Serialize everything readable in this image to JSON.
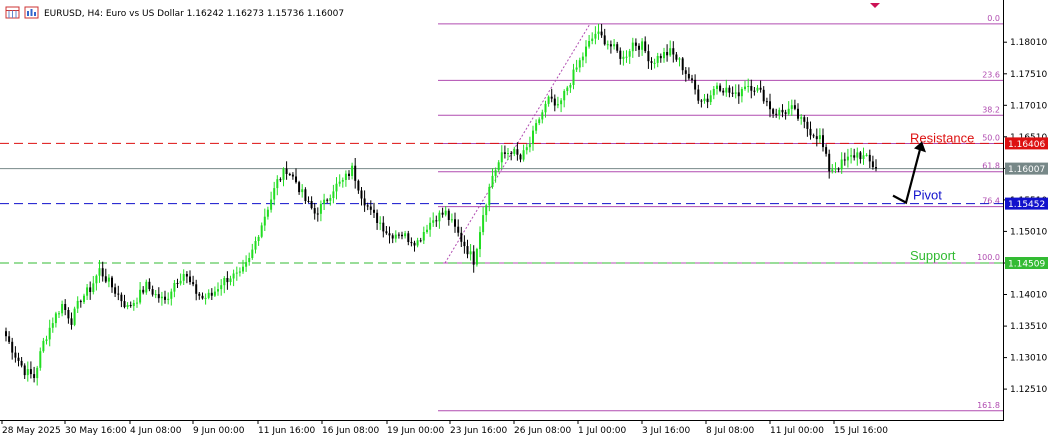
{
  "header": {
    "symbol_line": "EURUSD, H4:  Euro vs US Dollar  1.16242  1.16273  1.15736  1.16007"
  },
  "colors": {
    "bull": "#22dd22",
    "bear": "#000000",
    "resistance": "#dd1111",
    "pivot": "#1111cc",
    "support": "#33bb33",
    "fib": "#b04cb0",
    "current": "#778888"
  },
  "chart_data": {
    "type": "candlestick",
    "symbol": "EURUSD",
    "timeframe": "H4",
    "ohlc_header": {
      "open": 1.16242,
      "high": 1.16273,
      "low": 1.15736,
      "close": 1.16007
    },
    "ylim": [
      1.121,
      1.186
    ],
    "y_ticks": [
      "1.18010",
      "1.17510",
      "1.17010",
      "1.16510",
      "1.16010",
      "1.15510",
      "1.15010",
      "1.14510",
      "1.14010",
      "1.13510",
      "1.13010",
      "1.12510"
    ],
    "x_ticks": [
      "28 May 2025",
      "30 May 16:00",
      "4 Jun 08:00",
      "9 Jun 00:00",
      "11 Jun 16:00",
      "16 Jun 08:00",
      "19 Jun 00:00",
      "23 Jun 16:00",
      "26 Jun 08:00",
      "1 Jul 00:00",
      "3 Jul 16:00",
      "8 Jul 08:00",
      "11 Jul 00:00",
      "15 Jul 16:00"
    ],
    "anchors": [
      [
        0,
        1.1335
      ],
      [
        3,
        1.1305
      ],
      [
        6,
        1.128
      ],
      [
        9,
        1.127
      ],
      [
        12,
        1.1325
      ],
      [
        15,
        1.136
      ],
      [
        18,
        1.1385
      ],
      [
        21,
        1.136
      ],
      [
        24,
        1.1395
      ],
      [
        27,
        1.141
      ],
      [
        30,
        1.144
      ],
      [
        33,
        1.142
      ],
      [
        36,
        1.14
      ],
      [
        39,
        1.138
      ],
      [
        42,
        1.1395
      ],
      [
        45,
        1.1415
      ],
      [
        48,
        1.14
      ],
      [
        51,
        1.139
      ],
      [
        54,
        1.142
      ],
      [
        57,
        1.1435
      ],
      [
        60,
        1.141
      ],
      [
        63,
        1.1395
      ],
      [
        66,
        1.14
      ],
      [
        69,
        1.142
      ],
      [
        72,
        1.143
      ],
      [
        75,
        1.143
      ],
      [
        78,
        1.1455
      ],
      [
        81,
        1.15
      ],
      [
        84,
        1.154
      ],
      [
        87,
        1.158
      ],
      [
        90,
        1.16
      ],
      [
        93,
        1.158
      ],
      [
        96,
        1.155
      ],
      [
        99,
        1.153
      ],
      [
        102,
        1.1545
      ],
      [
        105,
        1.157
      ],
      [
        108,
        1.158
      ],
      [
        111,
        1.16
      ],
      [
        114,
        1.156
      ],
      [
        117,
        1.153
      ],
      [
        120,
        1.1515
      ],
      [
        123,
        1.1495
      ],
      [
        126,
        1.15
      ],
      [
        129,
        1.149
      ],
      [
        132,
        1.1485
      ],
      [
        135,
        1.151
      ],
      [
        138,
        1.1525
      ],
      [
        141,
        1.153
      ],
      [
        144,
        1.1505
      ],
      [
        147,
        1.148
      ],
      [
        150,
        1.1455
      ],
      [
        153,
        1.153
      ],
      [
        156,
        1.159
      ],
      [
        159,
        1.162
      ],
      [
        162,
        1.163
      ],
      [
        165,
        1.1615
      ],
      [
        168,
        1.164
      ],
      [
        171,
        1.168
      ],
      [
        174,
        1.171
      ],
      [
        177,
        1.1695
      ],
      [
        180,
        1.173
      ],
      [
        183,
        1.176
      ],
      [
        186,
        1.179
      ],
      [
        189,
        1.1815
      ],
      [
        192,
        1.1805
      ],
      [
        195,
        1.179
      ],
      [
        198,
        1.1775
      ],
      [
        201,
        1.18
      ],
      [
        204,
        1.1795
      ],
      [
        207,
        1.177
      ],
      [
        210,
        1.178
      ],
      [
        213,
        1.1785
      ],
      [
        216,
        1.177
      ],
      [
        219,
        1.1745
      ],
      [
        222,
        1.1715
      ],
      [
        225,
        1.171
      ],
      [
        228,
        1.1735
      ],
      [
        231,
        1.1725
      ],
      [
        234,
        1.1715
      ],
      [
        237,
        1.1735
      ],
      [
        240,
        1.173
      ],
      [
        243,
        1.1715
      ],
      [
        246,
        1.169
      ],
      [
        249,
        1.169
      ],
      [
        252,
        1.1695
      ],
      [
        255,
        1.1675
      ],
      [
        258,
        1.166
      ],
      [
        261,
        1.165
      ],
      [
        264,
        1.16
      ],
      [
        267,
        1.1605
      ],
      [
        270,
        1.1615
      ],
      [
        273,
        1.1625
      ],
      [
        276,
        1.1615
      ],
      [
        279,
        1.1601
      ]
    ],
    "hlines": [
      {
        "label": "Resistance",
        "price": 1.16406,
        "tag": "1.16406",
        "color": "#dd1111",
        "style": "dashed"
      },
      {
        "label": "Pivot",
        "price": 1.15452,
        "tag": "1.15452",
        "color": "#1111cc",
        "style": "dashed"
      },
      {
        "label": "Support",
        "price": 1.14509,
        "tag": "1.14509",
        "color": "#33bb33",
        "style": "dashed"
      },
      {
        "label": "",
        "price": 1.16007,
        "tag": "1.16007",
        "color": "#778888",
        "style": "solid"
      }
    ],
    "fibonacci": {
      "high_price": 1.183,
      "low_price": 1.14509,
      "levels": [
        {
          "label": "0.0",
          "ratio": 0.0
        },
        {
          "label": "23.6",
          "ratio": 0.236
        },
        {
          "label": "38.2",
          "ratio": 0.382
        },
        {
          "label": "50.0",
          "ratio": 0.5
        },
        {
          "label": "61.8",
          "ratio": 0.618
        },
        {
          "label": "76.4",
          "ratio": 0.764
        },
        {
          "label": "100.0",
          "ratio": 1.0
        },
        {
          "label": "161.8",
          "ratio": 1.618
        }
      ]
    }
  }
}
